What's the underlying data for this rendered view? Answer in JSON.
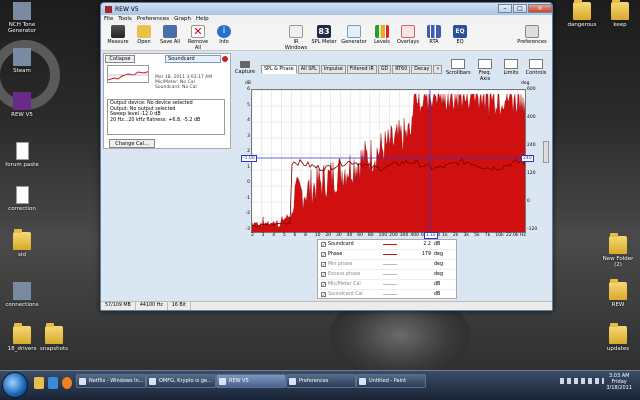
{
  "desktop": {
    "left_icons": [
      {
        "label": "NCH Tone Generator",
        "kind": "app"
      },
      {
        "label": "Steam",
        "kind": "app"
      },
      {
        "label": "REW V5",
        "kind": "app"
      },
      {
        "label": "forum paste",
        "kind": "doc"
      },
      {
        "label": "correction",
        "kind": "doc"
      },
      {
        "label": "sid",
        "kind": "folder"
      },
      {
        "label": "connections",
        "kind": "app"
      },
      {
        "label": "18_drivers",
        "kind": "folder"
      },
      {
        "label": "snapshots",
        "kind": "folder"
      }
    ],
    "right_icons": [
      {
        "label": "dangerous",
        "kind": "folder"
      },
      {
        "label": "keep",
        "kind": "folder"
      },
      {
        "label": "New Folder (2)",
        "kind": "folder"
      },
      {
        "label": "REW",
        "kind": "folder"
      },
      {
        "label": "updates",
        "kind": "folder"
      }
    ]
  },
  "window": {
    "title": "REW V5",
    "menu": [
      "File",
      "Tools",
      "Preferences",
      "Graph",
      "Help"
    ],
    "toolbar": {
      "measure": "Measure",
      "open": "Open",
      "save_all": "Save All",
      "remove_all": "Remove All",
      "info": "Info",
      "ir_windows": "IR Windows",
      "spl_value": "83",
      "spl_meter": "SPL Meter",
      "generator": "Generator",
      "levels": "Levels",
      "overlays": "Overlays",
      "rta": "RTA",
      "eq": "EQ",
      "preferences": "Preferences"
    },
    "left_panel": {
      "collapse": "Collapse",
      "measurement_name": "Soundcard",
      "meta_lines": [
        "Mar 18, 2011 3:03:17 AM",
        "Mic/Meter: No Cal",
        "Soundcard: No Cal"
      ],
      "info_lines": [
        "Output device: No device selected",
        "Output: No output selected",
        "Sweep level -12.0 dB",
        "20 Hz...20 kHz flatness: +6.8, -5.2 dB"
      ],
      "change_cal": "Change Cal..."
    },
    "graph": {
      "capture": "Capture",
      "tabs": [
        "SPL & Phase",
        "All SPL",
        "Impulse",
        "Filtered IR",
        "GD",
        "RT60",
        "Decay",
        "»"
      ],
      "active_tab": 0,
      "right_tools": [
        "Scrollbars",
        "Freq. Axis",
        "Limits",
        "Controls"
      ],
      "left_unit": "dB",
      "right_unit": "deg",
      "cursor_left": "-5.00",
      "cursor_right": "240",
      "cursor_freq": "1.1k",
      "x_ticks": [
        "2",
        "3",
        "4",
        "5",
        "6",
        "8",
        "10",
        "20",
        "30",
        "40",
        "60",
        "80",
        "100",
        "200",
        "300",
        "400",
        "600",
        "800",
        "1k",
        "2k",
        "3k",
        "5k",
        "7k",
        "10k",
        "22.0k Hz"
      ],
      "y_left_ticks": [
        "6",
        "5",
        "4",
        "3",
        "2",
        "1",
        "0",
        "-1",
        "-2",
        "-3"
      ],
      "y_right_ticks": [
        "600",
        "400",
        "240",
        "120",
        "0",
        "-120"
      ]
    },
    "legend": [
      {
        "name": "Soundcard",
        "checked": true,
        "color": "#d01010",
        "value": "2.2",
        "unit": "dB"
      },
      {
        "name": "Phase",
        "checked": true,
        "color": "#d01010",
        "value": "179",
        "unit": "deg"
      },
      {
        "name": "Min phase",
        "checked": true,
        "color": "#bbbbbb",
        "value": "",
        "unit": "deg"
      },
      {
        "name": "Excess phase",
        "checked": true,
        "color": "#bbbbbb",
        "value": "",
        "unit": "deg"
      },
      {
        "name": "Mic/Meter Cal",
        "checked": true,
        "color": "#bbbbbb",
        "value": "",
        "unit": "dB"
      },
      {
        "name": "Soundcard Cal",
        "checked": true,
        "color": "#bbbbbb",
        "value": "",
        "unit": "dB"
      }
    ],
    "status": [
      "57/109 MB",
      "44100 Hz",
      "16 Bit"
    ]
  },
  "taskbar": {
    "buttons": [
      {
        "label": "Netflix - Windows In...",
        "active": false
      },
      {
        "label": "OMFG, Krypto is ge...",
        "active": false
      },
      {
        "label": "REW V5",
        "active": true
      },
      {
        "label": "Preferences",
        "active": false
      },
      {
        "label": "Untitled - Paint",
        "active": false
      }
    ],
    "clock_time": "3:03 AM",
    "clock_day": "Friday",
    "clock_date": "3/18/2011"
  },
  "colors": {
    "accent_red": "#d01010",
    "cursor_blue": "#2d36c8"
  }
}
